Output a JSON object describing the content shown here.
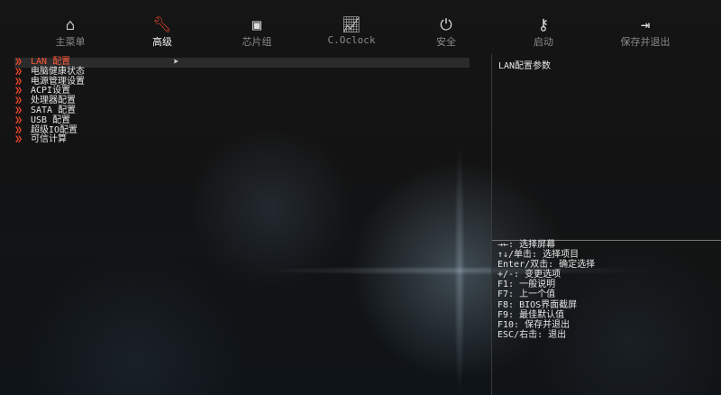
{
  "tabs": [
    {
      "label": "主菜单",
      "icon": "home-icon",
      "glyph": "⌂"
    },
    {
      "label": "高级",
      "icon": "wrench-icon",
      "glyph": "🔧︎"
    },
    {
      "label": "芯片组",
      "icon": "chip-icon",
      "glyph": "▣"
    },
    {
      "label": "C.Oclock",
      "icon": "chart-icon",
      "glyph": "📈︎"
    },
    {
      "label": "安全",
      "icon": "power-icon",
      "glyph": "⏻"
    },
    {
      "label": "启动",
      "icon": "key-icon",
      "glyph": "⚷"
    },
    {
      "label": "保存并退出",
      "icon": "exit-door-icon",
      "glyph": "⇥"
    }
  ],
  "active_tab": "高级",
  "menu": [
    "LAN 配置",
    "电脑健康状态",
    "电源管理设置",
    "ACPI设置",
    "处理器配置",
    "SATA 配置",
    "USB 配置",
    "超级IO配置",
    "可信计算"
  ],
  "description": "LAN配置参数",
  "help": [
    "→←: 选择屏幕",
    "↑↓/单击: 选择项目",
    "Enter/双击: 确定选择",
    "+/-: 变更选项",
    "F1: 一般说明",
    "F7: 上一个值",
    "F8: BIOS界面截屏",
    "F9: 最佳默认值",
    "F10: 保存并退出",
    "ESC/右击: 退出"
  ],
  "colors": {
    "accent": "#e8452a"
  }
}
